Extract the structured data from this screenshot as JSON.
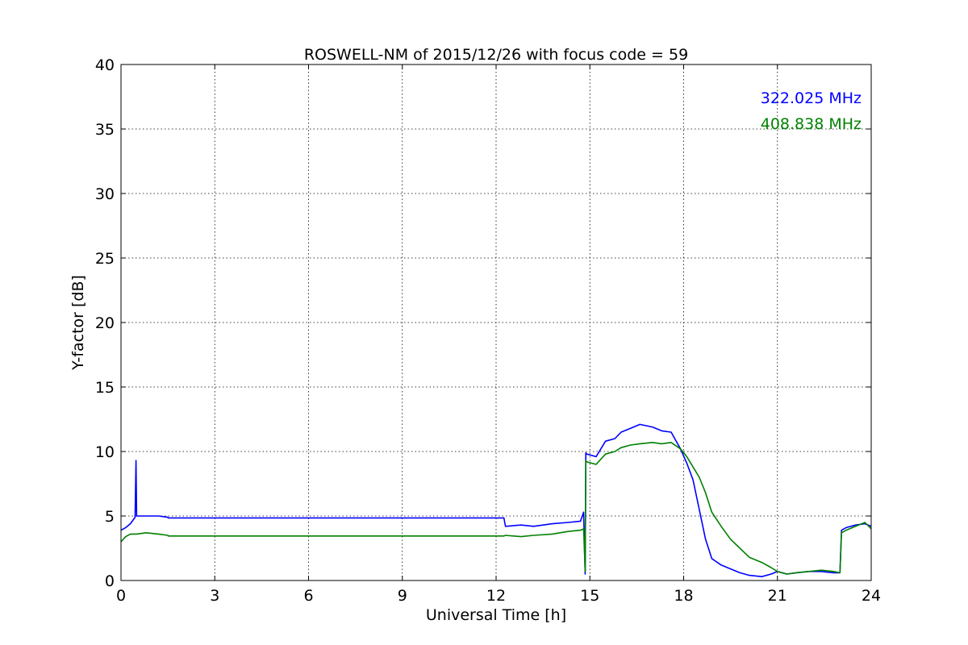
{
  "chart_data": {
    "type": "line",
    "title": "ROSWELL-NM of 2015/12/26 with focus code = 59",
    "xlabel": "Universal Time [h]",
    "ylabel": "Y-factor [dB]",
    "xlim": [
      0,
      24
    ],
    "ylim": [
      0,
      40
    ],
    "xticks": [
      0,
      3,
      6,
      9,
      12,
      15,
      18,
      21,
      24
    ],
    "yticks": [
      0,
      5,
      10,
      15,
      20,
      25,
      30,
      35,
      40
    ],
    "grid": true,
    "legend_position": "top-right",
    "series": [
      {
        "name": "322.025 MHz",
        "color": "#0000ff",
        "x": [
          0.0,
          0.15,
          0.3,
          0.45,
          0.48,
          0.5,
          0.55,
          0.8,
          1.2,
          1.5,
          1.51,
          12.25,
          12.3,
          12.8,
          13.2,
          13.8,
          14.3,
          14.7,
          14.8,
          14.85,
          14.87,
          14.9,
          15.2,
          15.5,
          15.8,
          16.0,
          16.3,
          16.6,
          17.0,
          17.3,
          17.6,
          17.9,
          18.1,
          18.3,
          18.5,
          18.7,
          18.9,
          19.2,
          19.5,
          19.8,
          20.1,
          20.5,
          20.8,
          21.0,
          21.3,
          21.6,
          22.0,
          22.4,
          22.8,
          23.0,
          23.05,
          23.2,
          23.5,
          23.8,
          24.0
        ],
        "y": [
          3.9,
          4.1,
          4.4,
          4.9,
          9.3,
          5.0,
          5.0,
          5.0,
          5.0,
          4.9,
          4.85,
          4.85,
          4.2,
          4.3,
          4.2,
          4.4,
          4.5,
          4.6,
          5.3,
          0.5,
          9.9,
          9.8,
          9.6,
          10.8,
          11.0,
          11.5,
          11.8,
          12.1,
          11.9,
          11.6,
          11.5,
          10.2,
          9.1,
          7.8,
          5.5,
          3.2,
          1.7,
          1.2,
          0.9,
          0.6,
          0.4,
          0.3,
          0.5,
          0.7,
          0.5,
          0.6,
          0.7,
          0.7,
          0.6,
          0.6,
          3.9,
          4.1,
          4.3,
          4.4,
          4.2
        ]
      },
      {
        "name": "408.838 MHz",
        "color": "#008000",
        "x": [
          0.0,
          0.15,
          0.3,
          0.5,
          0.8,
          1.2,
          1.5,
          1.51,
          12.25,
          12.3,
          12.8,
          13.2,
          13.8,
          14.3,
          14.7,
          14.8,
          14.85,
          14.87,
          14.9,
          15.2,
          15.5,
          15.8,
          16.0,
          16.3,
          16.6,
          17.0,
          17.3,
          17.6,
          17.9,
          18.1,
          18.3,
          18.5,
          18.7,
          18.9,
          19.2,
          19.5,
          19.8,
          20.1,
          20.5,
          20.8,
          21.0,
          21.3,
          21.6,
          22.0,
          22.4,
          22.8,
          23.0,
          23.05,
          23.2,
          23.5,
          23.8,
          24.0
        ],
        "y": [
          3.0,
          3.4,
          3.6,
          3.6,
          3.7,
          3.6,
          3.5,
          3.45,
          3.45,
          3.5,
          3.4,
          3.5,
          3.6,
          3.8,
          3.9,
          4.0,
          0.7,
          9.3,
          9.2,
          9.0,
          9.8,
          10.0,
          10.3,
          10.5,
          10.6,
          10.7,
          10.6,
          10.7,
          10.2,
          9.6,
          8.8,
          8.0,
          6.8,
          5.3,
          4.2,
          3.2,
          2.5,
          1.8,
          1.4,
          1.0,
          0.7,
          0.5,
          0.6,
          0.7,
          0.8,
          0.7,
          0.6,
          3.7,
          3.9,
          4.2,
          4.5,
          4.0
        ]
      }
    ]
  }
}
